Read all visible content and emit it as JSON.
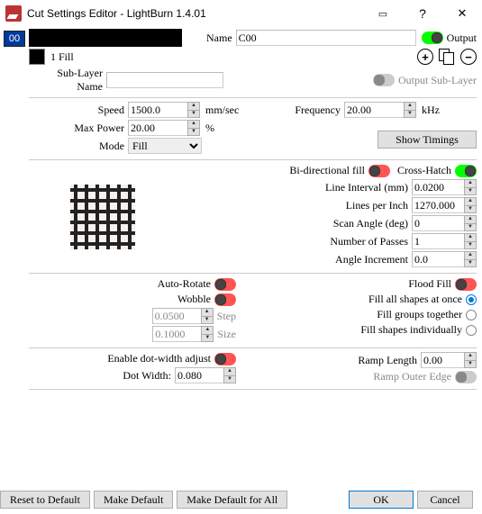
{
  "window": {
    "title": "Cut Settings Editor - LightBurn 1.4.01"
  },
  "left": {
    "layer": "00"
  },
  "top": {
    "name_label": "Name",
    "name_value": "C00",
    "output_label": "Output",
    "fill_label": "1 Fill",
    "sublayer_name_label": "Sub-Layer Name",
    "sublayer_name_value": "",
    "output_sublayer_label": "Output Sub-Layer"
  },
  "basic": {
    "speed_label": "Speed",
    "speed_value": "1500.0",
    "speed_unit": "mm/sec",
    "maxpower_label": "Max Power",
    "maxpower_value": "20.00",
    "maxpower_unit": "%",
    "mode_label": "Mode",
    "mode_value": "Fill",
    "freq_label": "Frequency",
    "freq_value": "20.00",
    "freq_unit": "kHz",
    "show_timings": "Show Timings"
  },
  "fill": {
    "bidir_label": "Bi-directional fill",
    "cross_label": "Cross-Hatch",
    "line_int_label": "Line Interval (mm)",
    "line_int_value": "0.0200",
    "lpi_label": "Lines per Inch",
    "lpi_value": "1270.000",
    "scan_label": "Scan Angle (deg)",
    "scan_value": "0",
    "passes_label": "Number of Passes",
    "passes_value": "1",
    "angle_inc_label": "Angle Increment",
    "angle_inc_value": "0.0"
  },
  "extra": {
    "auto_rotate": "Auto-Rotate",
    "wobble": "Wobble",
    "step_val": "0.0500",
    "step_lbl": "Step",
    "size_val": "0.1000",
    "size_lbl": "Size",
    "flood": "Flood Fill",
    "fill_all": "Fill all shapes at once",
    "fill_groups": "Fill groups together",
    "fill_indiv": "Fill shapes individually"
  },
  "dot": {
    "enable_label": "Enable dot-width adjust",
    "dot_width_label": "Dot Width:",
    "dot_width_value": "0.080",
    "ramp_len_label": "Ramp Length",
    "ramp_len_value": "0.00",
    "ramp_edge_label": "Ramp Outer Edge"
  },
  "bottom": {
    "reset": "Reset to Default",
    "make_def": "Make Default",
    "make_def_all": "Make Default for All",
    "ok": "OK",
    "cancel": "Cancel"
  }
}
